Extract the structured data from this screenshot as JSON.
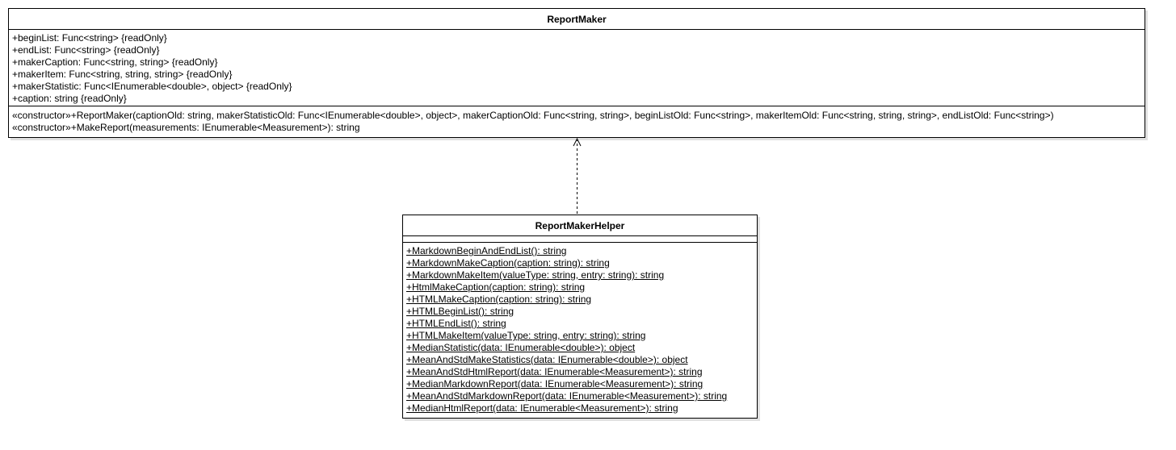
{
  "classes": {
    "report_maker": {
      "name": "ReportMaker",
      "attributes": [
        "+beginList: Func<string> {readOnly}",
        "+endList: Func<string> {readOnly}",
        "+makerCaption: Func<string, string> {readOnly}",
        "+makerItem: Func<string, string, string> {readOnly}",
        "+makerStatistic: Func<IEnumerable<double>, object> {readOnly}",
        "+caption: string {readOnly}"
      ],
      "operations": [
        "«constructor»+ReportMaker(captionOld: string, makerStatisticOld: Func<IEnumerable<double>, object>, makerCaptionOld: Func<string, string>, beginListOld: Func<string>, makerItemOld: Func<string, string, string>, endListOld: Func<string>)",
        "«constructor»+MakeReport(measurements: IEnumerable<Measurement>): string"
      ]
    },
    "report_maker_helper": {
      "name": "ReportMakerHelper",
      "attributes": [],
      "operations": [
        "+MarkdownBeginAndEndList(): string",
        "+MarkdownMakeCaption(caption: string): string",
        "+MarkdownMakeItem(valueType: string, entry: string): string",
        "+HtmlMakeCaption(caption: string): string",
        "+HTMLMakeCaption(caption: string): string",
        "+HTMLBeginList(): string",
        "+HTMLEndList(): string",
        "+HTMLMakeItem(valueType: string, entry: string): string",
        "+MedianStatistic(data: IEnumerable<double>): object",
        "+MeanAndStdMakeStatistics(data: IEnumerable<double>): object",
        "+MeanAndStdHtmlReport(data: IEnumerable<Measurement>): string",
        "+MedianMarkdownReport(data: IEnumerable<Measurement>): string",
        "+MeanAndStdMarkdownReport(data: IEnumerable<Measurement>): string",
        "+MedianHtmlReport(data: IEnumerable<Measurement>): string"
      ]
    }
  },
  "relationships": [
    {
      "from": "ReportMakerHelper",
      "to": "ReportMaker",
      "kind": "dependency"
    }
  ]
}
